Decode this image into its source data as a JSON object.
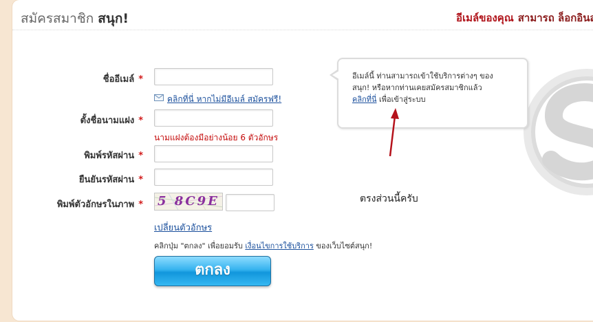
{
  "header": {
    "title": "สมัครสมาชิก",
    "brand": "สนุก!",
    "right_emphasis": "อีเมล์ของคุณ",
    "right_text": "สามารถ ล็อกอินส"
  },
  "form": {
    "email_label": "ชื่ออีเมล์",
    "email_value": "",
    "no_email_link": "คลิกที่นี่ หากไม่มีอีเมล์ สมัครฟรี!",
    "alias_label": "ตั้งชื่อนามแฝง",
    "alias_value": "",
    "alias_error": "นามแฝงต้องมีอย่างน้อย 6 ตัวอักษร",
    "password_label": "พิมพ์รหัสผ่าน",
    "confirm_label": "ยืนยันรหัสผ่าน",
    "captcha_label": "พิมพ์ตัวอักษรในภาพ",
    "captcha_text": "5 8C9E",
    "captcha_value": "",
    "change_captcha_link": "เปลี่ยนตัวอักษร",
    "required_mark": "*",
    "agree_prefix": "คลิกปุ่ม \"ตกลง\" เพื่อยอมรับ",
    "agree_link": "เงื่อนไขการใช้บริการ",
    "agree_suffix": "ของเว็บไซต์สนุก!",
    "submit_label": "ตกลง"
  },
  "tooltip": {
    "line1": "อีเมล์นี้ ท่านสามารถเข้าใช้บริการต่างๆ ของ",
    "line2": "สนุก! หรือหากท่านเคยสมัครสมาชิกแล้ว",
    "link": "คลิกที่นี่",
    "line3_suffix": "เพื่อเข้าสู่ระบบ"
  },
  "annotation": {
    "note": "ตรงส่วนนี้ครับ",
    "arrow_color": "#b5121b"
  },
  "colors": {
    "page_bg": "#f7e6d2",
    "accent_red": "#b0131a",
    "link_blue": "#1a4f9c",
    "button_blue": "#1196dc"
  },
  "icons": {
    "envelope": "mail-icon",
    "logo": "sanook-s-logo"
  }
}
